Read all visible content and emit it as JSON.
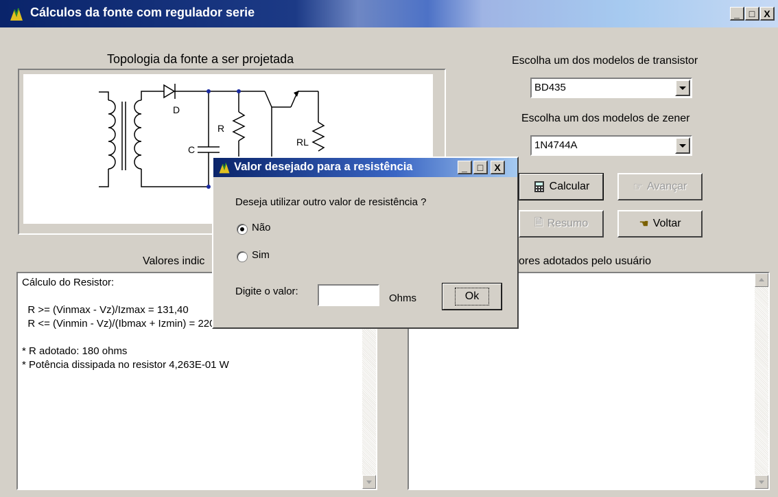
{
  "window": {
    "title": "Cálculos da fonte com regulador serie",
    "controls": [
      "_",
      "□",
      "X"
    ]
  },
  "topology": {
    "title": "Topologia da fonte a ser projetada",
    "labels": {
      "diode": "D",
      "capacitor": "C",
      "resistor": "R",
      "load": "RL"
    }
  },
  "transistor": {
    "label": "Escolha um dos modelos de transistor",
    "selected": "BD435"
  },
  "zener": {
    "label": "Escolha um dos modelos de zener",
    "selected": "1N4744A"
  },
  "buttons": {
    "calcular": "Calcular",
    "avancar": "Avançar",
    "resumo": "Resumo",
    "voltar": "Voltar"
  },
  "left_panel": {
    "label": "Valores indic",
    "lines": [
      "Cálculo do Resistor:",
      "",
      "  R >= (Vinmax - Vz)/Izmax = 131,40",
      "  R <= (Vinmin - Vz)/(Ibmax + Izmin) = 220,41 ohms",
      "",
      "* R adotado: 180 ohms",
      "* Potência dissipada no resistor 4,263E-01 W"
    ]
  },
  "right_panel": {
    "label": "ores adotados pelo usuário"
  },
  "dialog": {
    "title": "Valor desejado para a resistência",
    "question": "Deseja utilizar outro valor de resistência ?",
    "options": [
      {
        "label": "Não",
        "checked": true
      },
      {
        "label": "Sim",
        "checked": false
      }
    ],
    "input_label": "Digite o valor:",
    "input_value": "",
    "unit": "Ohms",
    "ok": "Ok"
  }
}
